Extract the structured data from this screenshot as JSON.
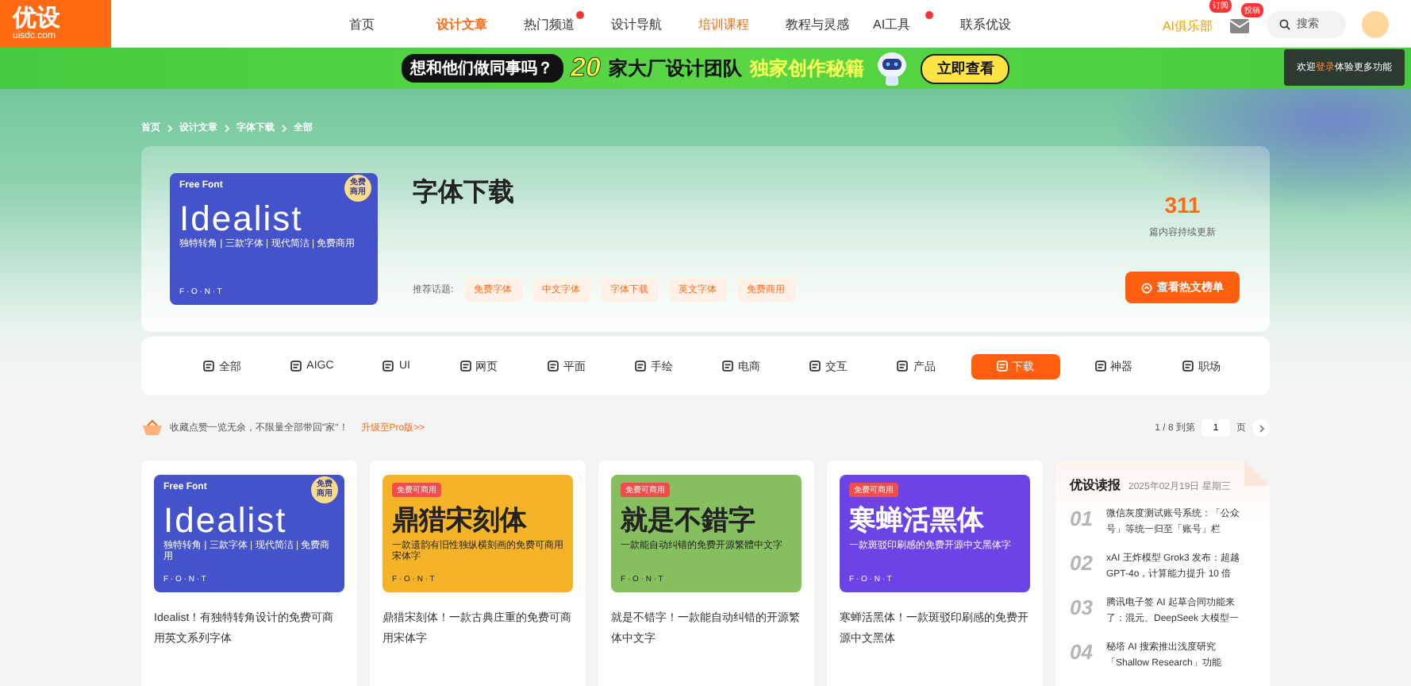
{
  "header": {
    "logo": {
      "name": "优设",
      "domain": "uisdc.com"
    },
    "nav": [
      {
        "label": "首页",
        "selected": false,
        "highlight": false,
        "badge": false
      },
      {
        "label": "设计文章",
        "selected": true,
        "highlight": false,
        "badge": false
      },
      {
        "label": "热门频道",
        "selected": false,
        "highlight": false,
        "badge": true
      },
      {
        "label": "设计导航",
        "selected": false,
        "highlight": false,
        "badge": false
      },
      {
        "label": "培训课程",
        "selected": false,
        "highlight": true,
        "badge": false
      },
      {
        "label": "教程与灵感",
        "selected": false,
        "highlight": false,
        "badge": false
      },
      {
        "label": "AI工具",
        "selected": false,
        "highlight": false,
        "badge": true
      },
      {
        "label": "联系优设",
        "selected": false,
        "highlight": false,
        "badge": false
      }
    ],
    "club": {
      "label": "AI俱乐部",
      "badge": "订阅"
    },
    "mail": {
      "badge": "投稿"
    },
    "search": {
      "placeholder": "搜索"
    }
  },
  "banner": {
    "question": "想和他们做同事吗？",
    "number": "20",
    "text": "家大厂设计团队",
    "highlight": "独家创作秘籍",
    "button": "立即查看"
  },
  "login_tip": "欢迎**登录**体验更多功能",
  "breadcrumb": [
    "首页",
    "设计文章",
    "字体下载",
    "全部"
  ],
  "hero": {
    "cover": {
      "kind": "round",
      "color": "#4453c9",
      "label": "Free Font",
      "badge": "免费商用",
      "title": "Idealist",
      "subtitle": "独特转角 | 三款字体 | 现代简洁 | 免费商用",
      "footer": "F · O · N · T"
    },
    "title": "字体下载",
    "topics_label": "推荐话题:",
    "topics": [
      "免费字体",
      "中文字体",
      "字体下载",
      "英文字体",
      "免费商用"
    ],
    "count": "311",
    "count_label": "篇内容持续更新",
    "button": "查看热文榜单"
  },
  "categories": [
    {
      "label": "全部",
      "selected": false
    },
    {
      "label": "AIGC",
      "selected": false
    },
    {
      "label": "UI",
      "selected": false
    },
    {
      "label": "网页",
      "selected": false
    },
    {
      "label": "平面",
      "selected": false
    },
    {
      "label": "手绘",
      "selected": false
    },
    {
      "label": "电商",
      "selected": false
    },
    {
      "label": "交互",
      "selected": false
    },
    {
      "label": "产品",
      "selected": false
    },
    {
      "label": "下载",
      "selected": true
    },
    {
      "label": "神器",
      "selected": false
    },
    {
      "label": "职场",
      "selected": false
    }
  ],
  "notice": {
    "text": "收藏点赞一览无余，不限量全部带回\"家\"！",
    "link": "升级至Pro版>>"
  },
  "pager": {
    "text": "1 / 8 到第",
    "value": "1",
    "unit": "页"
  },
  "articles": [
    {
      "cover": {
        "kind": "round",
        "color": "#4453c9",
        "label": "Free Font",
        "badge": "免费商用",
        "title": "Idealist",
        "subtitle": "独特转角 | 三款字体 | 现代简洁 | 免费商用",
        "footer": "F · O · N · T"
      },
      "title": "Idealist！有独特转角设计的免费可商用英文系列字体"
    },
    {
      "cover": {
        "kind": "tag",
        "color": "#f5b427",
        "badge": "免费可商用",
        "title": "鼎猎宋刻体",
        "subtitle": "一款遗韵有旧性独纵横刻画的免费可商用宋体字",
        "footer": "F · O · N · T"
      },
      "title": "鼎猎宋刻体！一款古典庄重的免费可商用宋体字"
    },
    {
      "cover": {
        "kind": "tag",
        "color": "#86c05e",
        "badge": "免费可商用",
        "title": "就是不錯字",
        "subtitle": "一款能自动纠错的免费开源繁體中文字",
        "footer": "F · O · N · T"
      },
      "title": "就是不错字！一款能自动纠错的开源繁体中文字"
    },
    {
      "cover": {
        "kind": "tag",
        "color": "#6b43e6",
        "badge": "免费可商用",
        "title": "寒蝉活黑体",
        "subtitle": "一款斑驳印刷感的免费开源中文黑体字",
        "footer": "F · O · N · T"
      },
      "title": "寒蝉活黑体！一款斑驳印刷感的免费开源中文黑体"
    }
  ],
  "news": {
    "title": "优设读报",
    "date": "2025年02月19日 星期三",
    "items": [
      {
        "number": "01",
        "text": "微信灰度测试账号系统：「公众号」等统一归至「账号」栏"
      },
      {
        "number": "02",
        "text": "xAI 王炸模型 Grok3 发布：超越 GPT-4o，计算能力提升 10 倍"
      },
      {
        "number": "03",
        "text": "腾讯电子签 AI 起草合同功能来了：混元、DeepSeek 大模型一"
      },
      {
        "number": "04",
        "text": "秘塔 AI 搜索推出浅度研究「Shallow Research」功能"
      }
    ]
  }
}
